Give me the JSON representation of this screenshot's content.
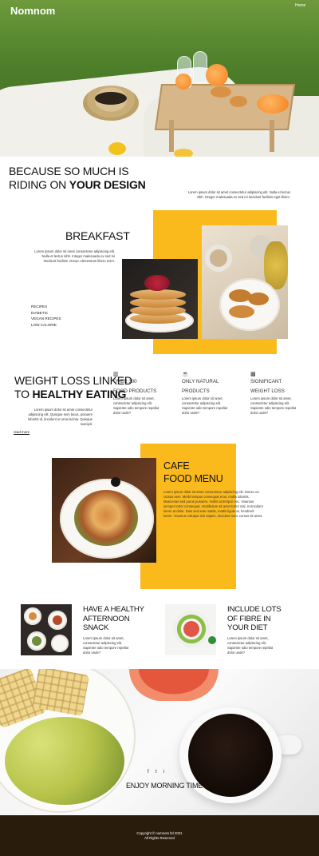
{
  "header": {
    "brand": "Nomnom",
    "nav": [
      "Home"
    ]
  },
  "intro": {
    "line1": "BECAUSE SO MUCH IS",
    "line2_light": "RIDING ON ",
    "line2_bold": "YOUR DESIGN",
    "text": "Lorem ipsum dolor sit amet consectetur adipiscing elit. Nulla et lectus nibh. Integer malesuada ex sed mi tincidunt facilisis eget libero."
  },
  "breakfast": {
    "title": "BREAKFAST",
    "text": "Lorem ipsum dolor sit amet consectetur adipiscing elit. Nulla et lectus nibh. Integer malesuada ex sed mi tincidunt facilisis. Donec elementum libero enim.",
    "list": [
      "RECIPES",
      "DIABETIC",
      "VEGAN RECIPES",
      "LOW CALORIE"
    ]
  },
  "weightloss": {
    "line1": "WEIGHT LOSS LINKED",
    "line2_light": "TO ",
    "line2_bold": "HEALTHY EATING",
    "text": "Lorem ipsum dolor sit amet consectetur adipiscing elit. Quisque sem lacus, posuere lobortis id, tincidunt ut urna lacinia. Quisque suscipit.",
    "read_more": "read more",
    "columns": [
      {
        "icon": "food-icon",
        "line1": "OVER 300",
        "line2": "FOOD PRODUCTS",
        "text": "Lorem ipsum dolor sit amet, consectetur adipiscing elit. Sapiente odio tempore repellat dolor unde?"
      },
      {
        "icon": "cup-icon",
        "line1": "ONLY NATURAL",
        "line2": "PRODUCTS",
        "text": "Lorem ipsum dolor sit amet, consectetur adipiscing elit. Sapiente odio tempore repellat dolor unde?"
      },
      {
        "icon": "scale-icon",
        "line1": "SIGNIFICANT",
        "line2": "WEIGHT LOSS",
        "text": "Lorem ipsum dolor sit amet, consectetur adipiscing elit. Sapiente odio tempore repellat dolor unde?"
      }
    ]
  },
  "cafe": {
    "line1": "CAFE",
    "line2": "FOOD MENU",
    "text": "Lorem ipsum dolor sit amet consectetur adipiscing elit. Donec eu cursus sem. Morbi tempus consequat eros, mollis lobortis. Maecenas sed purus posuere, mollis at tempor nec. Vivamus semper tortor consequat. Vestibulum sit amet tortor nisl, in tincidunt lorem at dolor. Duis sed ante mattis, mattis ligula at, hendrerit lorem. Vivamus volutpat nisi sapien, tincidunt nunc cursus sit amet."
  },
  "snacks": [
    {
      "title": "HAVE A HEALTHY AFTERNOON SNACK",
      "text": "Lorem ipsum dolor sit amet, consectetur adipiscing elit. Sapiente odio tempore repellat dolor unde?"
    },
    {
      "title": "INCLUDE LOTS OF FIBRE IN YOUR DIET",
      "text": "Lorem ipsum dolor sit amet, consectetur adipiscing elit. Sapiente odio tempore repellat dolor unde?"
    }
  ],
  "morning": {
    "text": "ENJOY MORNING TIME",
    "social": [
      "f",
      "t",
      "i"
    ]
  },
  "footer": {
    "line1": "Copyright © nomnom ltd 2021",
    "line2": "All Rights Reserved"
  },
  "colors": {
    "accent": "#FBBA1C",
    "footer": "#2a1c0d"
  }
}
